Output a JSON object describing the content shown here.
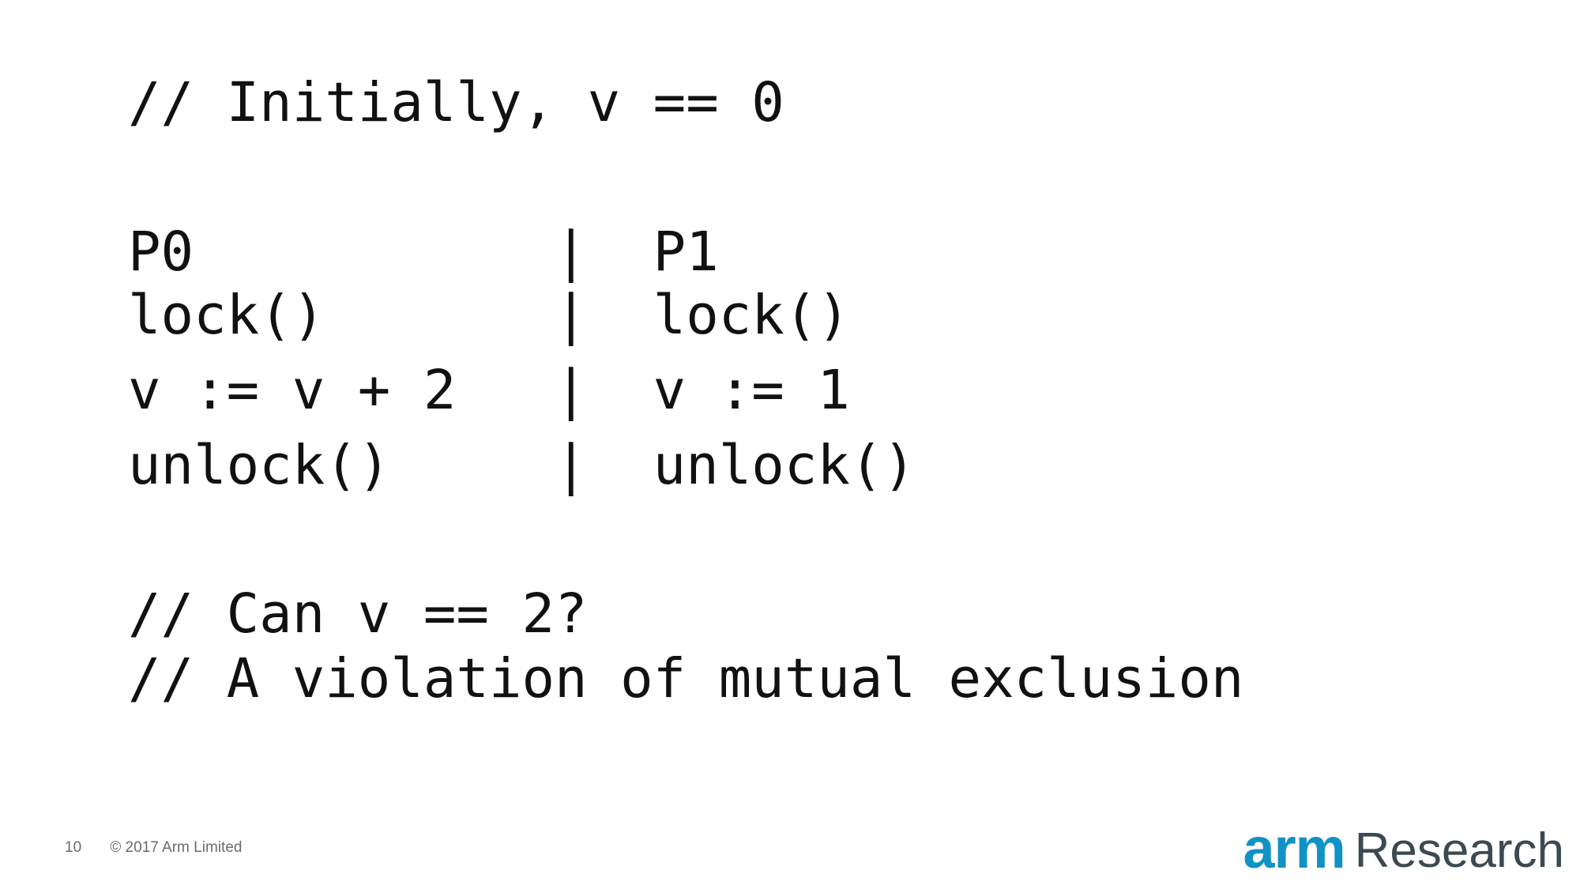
{
  "code": {
    "initial_comment": "// Initially, v == 0",
    "header_row": "P0           |  P1",
    "lock_row": "lock()       |  lock()",
    "update_row": "v := v + 2   |  v := 1",
    "unlock_row": "unlock()     |  unlock()",
    "question_comment": "// Can v == 2?",
    "answer_comment": "// A violation of mutual exclusion"
  },
  "footer": {
    "page_number": "10",
    "copyright": "© 2017 Arm Limited"
  },
  "logo": {
    "brand": "arm",
    "division": "Research",
    "brand_color": "#1192c6",
    "division_color": "#3a4a52"
  }
}
